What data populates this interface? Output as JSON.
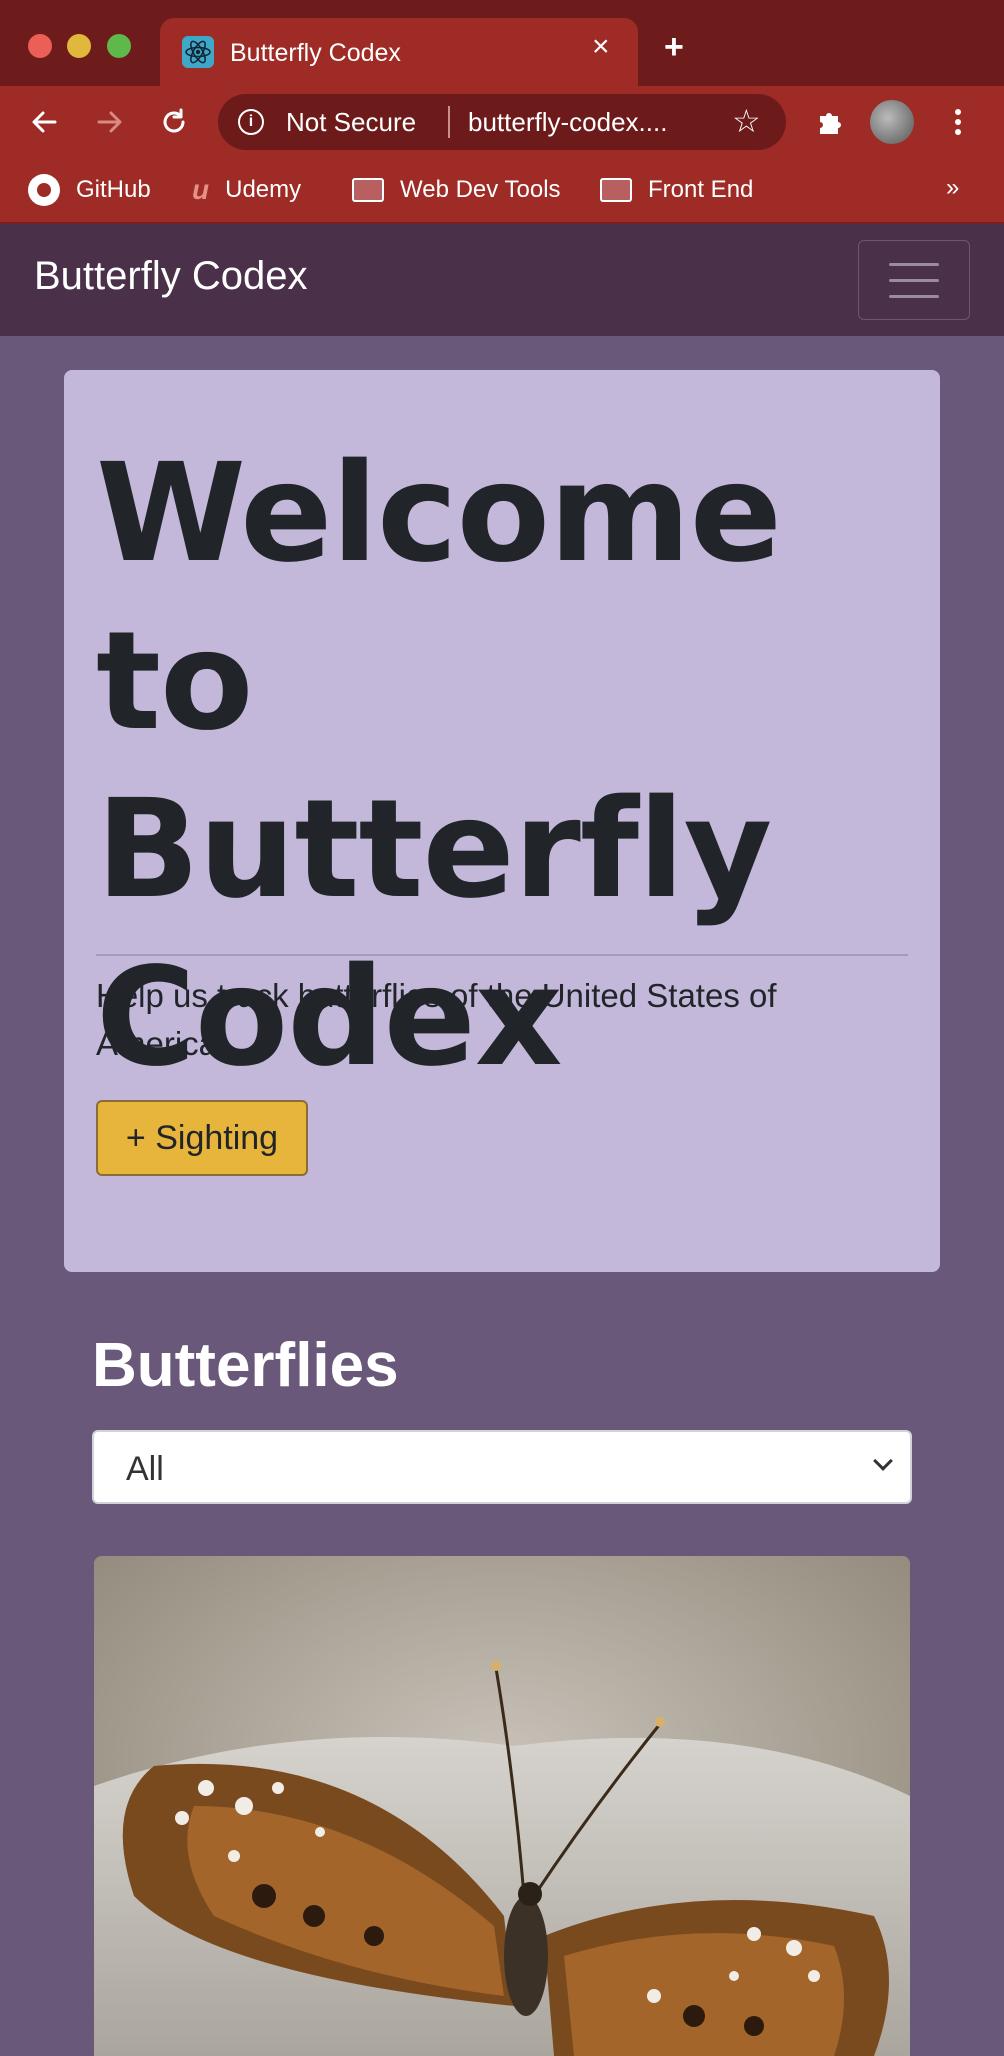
{
  "browser": {
    "tab_title": "Butterfly Codex",
    "tab_close": "×",
    "new_tab": "+",
    "security_label": "Not Secure",
    "url": "butterfly-codex....",
    "bookmarks": [
      {
        "label": "GitHub",
        "icon": "github-icon"
      },
      {
        "label": "Udemy",
        "icon": "udemy-icon"
      },
      {
        "label": "Web Dev Tools",
        "icon": "folder-icon"
      },
      {
        "label": "Front End",
        "icon": "folder-icon"
      }
    ],
    "bookmarks_more": "»"
  },
  "navbar": {
    "brand": "Butterfly Codex"
  },
  "jumbotron": {
    "title": "Welcome to Butterfly Codex",
    "lead": "Help us track butterflies of the United States of America",
    "button_label": "+ Sighting"
  },
  "butterflies": {
    "heading": "Butterflies",
    "filter_selected": "All"
  },
  "colors": {
    "chrome_dark": "#6e1b1b",
    "chrome": "#9e2b25",
    "navbar": "#4a3049",
    "page_bg": "#6a587b",
    "jumbotron": "#c4b8da",
    "accent_button": "#e7b53b"
  }
}
